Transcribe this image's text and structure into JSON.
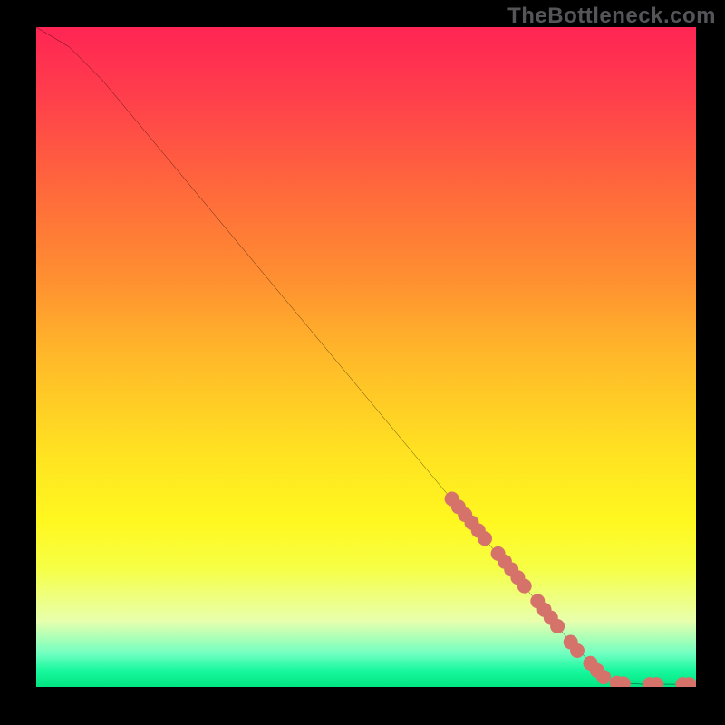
{
  "watermark": "TheBottleneck.com",
  "colors": {
    "frame_bg": "#000000",
    "line": "#000000",
    "marker_fill": "#d5736b",
    "marker_stroke": "#d5736b"
  },
  "chart_data": {
    "type": "line",
    "x_range": [
      0,
      100
    ],
    "y_range": [
      0,
      100
    ],
    "curve": [
      {
        "x": 0,
        "y": 100
      },
      {
        "x": 5,
        "y": 97
      },
      {
        "x": 10,
        "y": 92
      },
      {
        "x": 15,
        "y": 86
      },
      {
        "x": 20,
        "y": 80
      },
      {
        "x": 30,
        "y": 68
      },
      {
        "x": 40,
        "y": 56
      },
      {
        "x": 50,
        "y": 44
      },
      {
        "x": 60,
        "y": 32
      },
      {
        "x": 70,
        "y": 20
      },
      {
        "x": 80,
        "y": 8
      },
      {
        "x": 86,
        "y": 1.5
      },
      {
        "x": 88,
        "y": 0.6
      },
      {
        "x": 92,
        "y": 0.4
      },
      {
        "x": 100,
        "y": 0.4
      }
    ],
    "markers": [
      {
        "x": 63,
        "y": 28.5
      },
      {
        "x": 64,
        "y": 27.3
      },
      {
        "x": 65,
        "y": 26.1
      },
      {
        "x": 66,
        "y": 24.9
      },
      {
        "x": 67,
        "y": 23.7
      },
      {
        "x": 68,
        "y": 22.5
      },
      {
        "x": 70,
        "y": 20.2
      },
      {
        "x": 71,
        "y": 19.0
      },
      {
        "x": 72,
        "y": 17.8
      },
      {
        "x": 73,
        "y": 16.6
      },
      {
        "x": 74,
        "y": 15.3
      },
      {
        "x": 76,
        "y": 13.0
      },
      {
        "x": 77,
        "y": 11.7
      },
      {
        "x": 78,
        "y": 10.5
      },
      {
        "x": 79,
        "y": 9.2
      },
      {
        "x": 81,
        "y": 6.8
      },
      {
        "x": 82,
        "y": 5.5
      },
      {
        "x": 84,
        "y": 3.6
      },
      {
        "x": 85,
        "y": 2.5
      },
      {
        "x": 86,
        "y": 1.5
      },
      {
        "x": 88,
        "y": 0.6
      },
      {
        "x": 89,
        "y": 0.5
      },
      {
        "x": 93,
        "y": 0.4
      },
      {
        "x": 94,
        "y": 0.4
      },
      {
        "x": 98,
        "y": 0.4
      },
      {
        "x": 99,
        "y": 0.4
      }
    ],
    "marker_radius_px": 8,
    "title": "",
    "xlabel": "",
    "ylabel": "",
    "legend": false
  }
}
